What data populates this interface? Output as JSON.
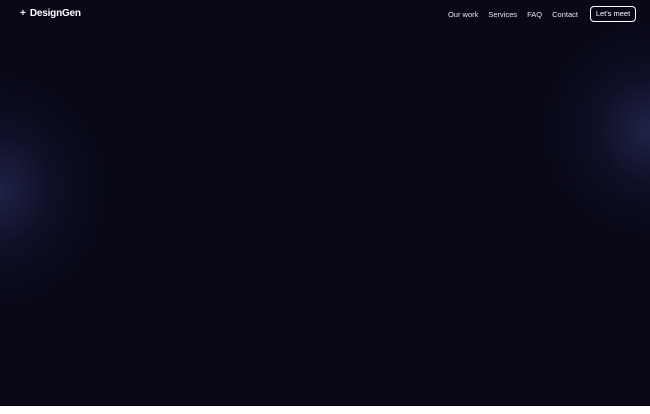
{
  "brand": {
    "mark": "+",
    "name": "DesignGen"
  },
  "nav": {
    "links": [
      "Our work",
      "Services",
      "FAQ",
      "Contact"
    ],
    "cta_label": "Let's meet"
  },
  "colors": {
    "background": "#080817",
    "glow": "#282c5a",
    "text": "#ffffff"
  }
}
